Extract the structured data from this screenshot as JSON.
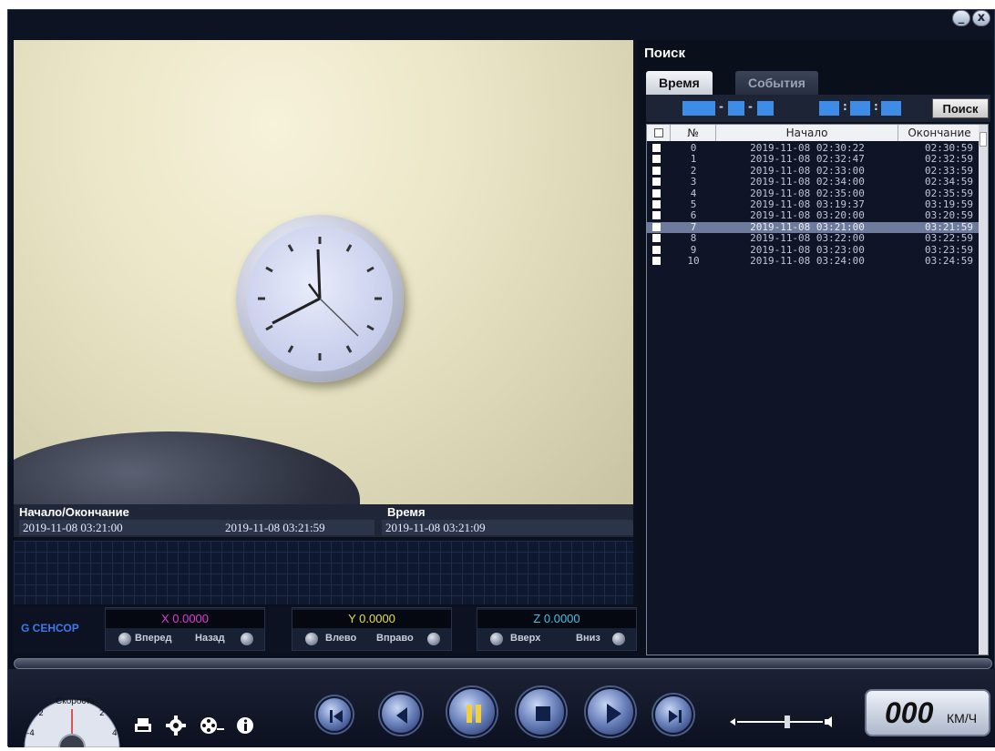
{
  "window": {
    "minimize": "_",
    "close": "x"
  },
  "info": {
    "start_end_label": "Начало/Окончание",
    "start_value": "2019-11-08  03:21:00",
    "end_value": "2019-11-08  03:21:59",
    "time_label": "Время",
    "time_value": "2019-11-08  03:21:09"
  },
  "gsensor": {
    "title": "G СЕНСОР",
    "x": {
      "value": "X 0.0000",
      "left": "Вперед",
      "right": "Назад",
      "color": "#e23bd6"
    },
    "y": {
      "value": "Y 0.0000",
      "left": "Влево",
      "right": "Вправо",
      "color": "#e4e03a"
    },
    "z": {
      "value": "Z 0.0000",
      "left": "Вверх",
      "right": "Вниз",
      "color": "#35c8e8"
    }
  },
  "search": {
    "title": "Поиск",
    "tabs": [
      "Время",
      "События"
    ],
    "button": "Поиск",
    "columns": [
      "№",
      "Начало",
      "Окончание"
    ],
    "rows": [
      {
        "n": "0",
        "start": "2019-11-08 02:30:22",
        "end": "02:30:59"
      },
      {
        "n": "1",
        "start": "2019-11-08 02:32:47",
        "end": "02:32:59"
      },
      {
        "n": "2",
        "start": "2019-11-08 02:33:00",
        "end": "02:33:59"
      },
      {
        "n": "3",
        "start": "2019-11-08 02:34:00",
        "end": "02:34:59"
      },
      {
        "n": "4",
        "start": "2019-11-08 02:35:00",
        "end": "02:35:59"
      },
      {
        "n": "5",
        "start": "2019-11-08 03:19:37",
        "end": "03:19:59"
      },
      {
        "n": "6",
        "start": "2019-11-08 03:20:00",
        "end": "03:20:59"
      },
      {
        "n": "7",
        "start": "2019-11-08 03:21:00",
        "end": "03:21:59"
      },
      {
        "n": "8",
        "start": "2019-11-08 03:22:00",
        "end": "03:22:59"
      },
      {
        "n": "9",
        "start": "2019-11-08 03:23:00",
        "end": "03:23:59"
      },
      {
        "n": "10",
        "start": "2019-11-08 03:24:00",
        "end": "03:24:59"
      }
    ],
    "selected_row": 7
  },
  "speed": {
    "label": "Скорость",
    "ticks": [
      "-4",
      "-2",
      "2",
      "4"
    ],
    "value": "000",
    "unit": "КМ/Ч"
  },
  "icons": {
    "tools": [
      "print-icon",
      "gear-icon",
      "film-reel-icon",
      "info-icon"
    ],
    "playback": [
      "skip-first-icon",
      "prev-icon",
      "pause-icon",
      "stop-icon",
      "play-icon",
      "skip-last-icon"
    ],
    "volume": [
      "volume-low-icon",
      "volume-high-icon"
    ]
  }
}
